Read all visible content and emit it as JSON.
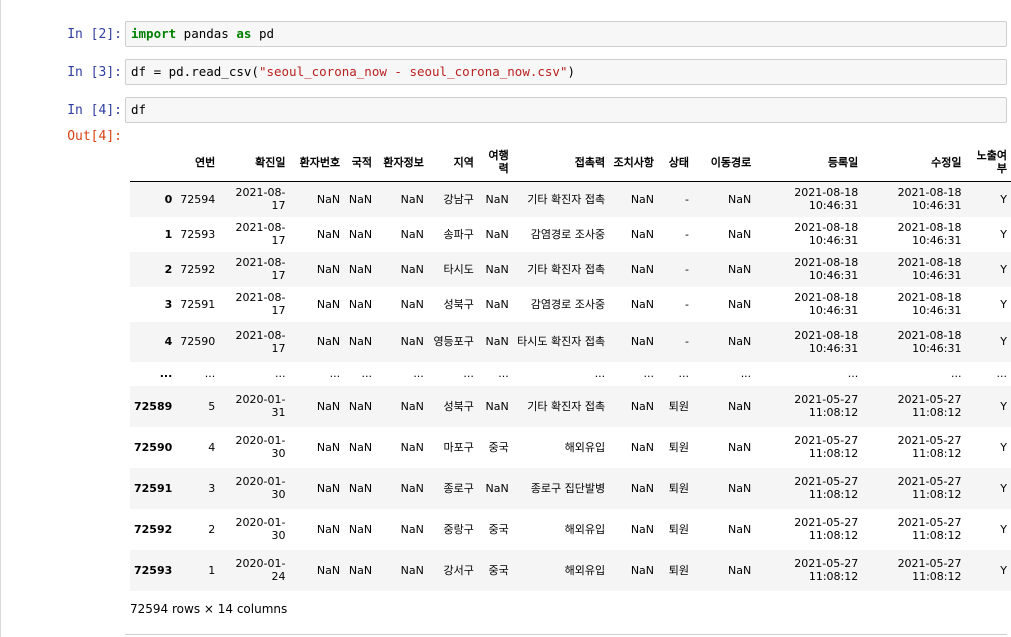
{
  "cells": [
    {
      "prompt": "In [2]:",
      "code": [
        {
          "t": "import",
          "c": "kw"
        },
        {
          "t": " pandas ",
          "c": ""
        },
        {
          "t": "as",
          "c": "kw"
        },
        {
          "t": " pd",
          "c": ""
        }
      ]
    },
    {
      "prompt": "In [3]:",
      "code": [
        {
          "t": "df = pd.read_csv(",
          "c": ""
        },
        {
          "t": "\"seoul_corona_now - seoul_corona_now.csv\"",
          "c": "str"
        },
        {
          "t": ")",
          "c": ""
        }
      ]
    },
    {
      "prompt": "In [4]:",
      "code": [
        {
          "t": "df",
          "c": ""
        }
      ]
    }
  ],
  "output_prompt": "Out[4]:",
  "table": {
    "columns": [
      "",
      "연번",
      "확진일",
      "환자번호",
      "국적",
      "환자정보",
      "지역",
      "여행력",
      "접촉력",
      "조치사항",
      "상태",
      "이동경로",
      "등록일",
      "수정일",
      "노출여부"
    ],
    "rows": [
      [
        "0",
        "72594",
        "2021-08-17",
        "NaN",
        "NaN",
        "NaN",
        "강남구",
        "NaN",
        "기타 확진자 접촉",
        "NaN",
        "-",
        "NaN",
        "2021-08-18 10:46:31",
        "2021-08-18 10:46:31",
        "Y"
      ],
      [
        "1",
        "72593",
        "2021-08-17",
        "NaN",
        "NaN",
        "NaN",
        "송파구",
        "NaN",
        "감염경로 조사중",
        "NaN",
        "-",
        "NaN",
        "2021-08-18 10:46:31",
        "2021-08-18 10:46:31",
        "Y"
      ],
      [
        "2",
        "72592",
        "2021-08-17",
        "NaN",
        "NaN",
        "NaN",
        "타시도",
        "NaN",
        "기타 확진자 접촉",
        "NaN",
        "-",
        "NaN",
        "2021-08-18 10:46:31",
        "2021-08-18 10:46:31",
        "Y"
      ],
      [
        "3",
        "72591",
        "2021-08-17",
        "NaN",
        "NaN",
        "NaN",
        "성북구",
        "NaN",
        "감염경로 조사중",
        "NaN",
        "-",
        "NaN",
        "2021-08-18 10:46:31",
        "2021-08-18 10:46:31",
        "Y"
      ],
      [
        "4",
        "72590",
        "2021-08-17",
        "NaN",
        "NaN",
        "NaN",
        "영등포구",
        "NaN",
        "타시도 확진자 접촉",
        "NaN",
        "-",
        "NaN",
        "2021-08-18 10:46:31",
        "2021-08-18 10:46:31",
        "Y"
      ],
      [
        "...",
        "...",
        "...",
        "...",
        "...",
        "...",
        "...",
        "...",
        "...",
        "...",
        "...",
        "...",
        "...",
        "...",
        "..."
      ],
      [
        "72589",
        "5",
        "2020-01-31",
        "NaN",
        "NaN",
        "NaN",
        "성북구",
        "NaN",
        "기타 확진자 접촉",
        "NaN",
        "퇴원",
        "NaN",
        "2021-05-27 11:08:12",
        "2021-05-27 11:08:12",
        "Y"
      ],
      [
        "72590",
        "4",
        "2020-01-30",
        "NaN",
        "NaN",
        "NaN",
        "마포구",
        "중국",
        "해외유입",
        "NaN",
        "퇴원",
        "NaN",
        "2021-05-27 11:08:12",
        "2021-05-27 11:08:12",
        "Y"
      ],
      [
        "72591",
        "3",
        "2020-01-30",
        "NaN",
        "NaN",
        "NaN",
        "종로구",
        "NaN",
        "종로구 집단발병",
        "NaN",
        "퇴원",
        "NaN",
        "2021-05-27 11:08:12",
        "2021-05-27 11:08:12",
        "Y"
      ],
      [
        "72592",
        "2",
        "2020-01-30",
        "NaN",
        "NaN",
        "NaN",
        "중랑구",
        "중국",
        "해외유입",
        "NaN",
        "퇴원",
        "NaN",
        "2021-05-27 11:08:12",
        "2021-05-27 11:08:12",
        "Y"
      ],
      [
        "72593",
        "1",
        "2020-01-24",
        "NaN",
        "NaN",
        "NaN",
        "강서구",
        "중국",
        "해외유입",
        "NaN",
        "퇴원",
        "NaN",
        "2021-05-27 11:08:12",
        "2021-05-27 11:08:12",
        "Y"
      ]
    ]
  },
  "summary": "72594 rows × 14 columns"
}
